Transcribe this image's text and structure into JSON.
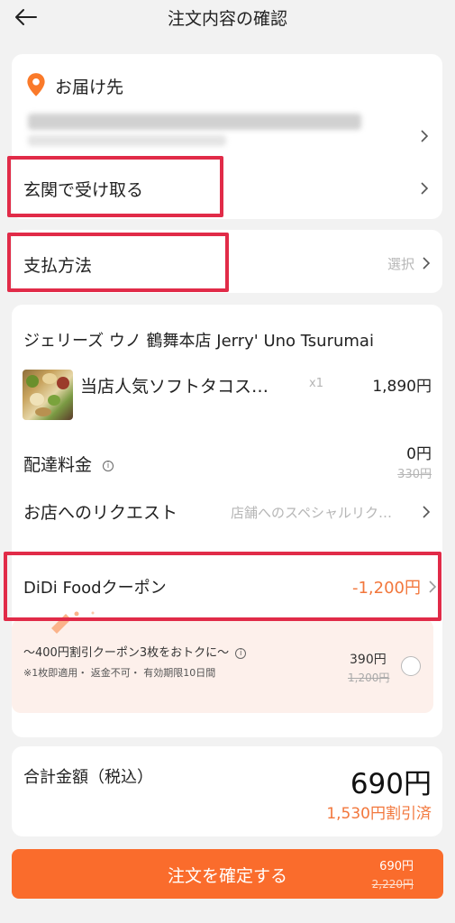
{
  "header": {
    "title": "注文内容の確認"
  },
  "delivery": {
    "title": "お届け先",
    "pickup_label": "玄関で受け取る"
  },
  "payment": {
    "label": "支払方法",
    "select_text": "選択"
  },
  "store": {
    "name": "ジェリーズ ウノ 鶴舞本店 Jerry' Uno Tsurumai",
    "item": {
      "name": "当店人気ソフトタコス…",
      "qty": "x1",
      "price": "1,890円"
    },
    "delivery_fee": {
      "label": "配達料金",
      "price": "0円",
      "original": "330円"
    },
    "request": {
      "label": "お店へのリクエスト",
      "placeholder": "店舗へのスペシャルリク…"
    }
  },
  "coupon": {
    "label": "DiDi Foodクーポン",
    "amount": "-1,200円",
    "promo_title": "～400円割引クーポン3枚をおトクに～",
    "promo_note": "※1枚即適用・ 返金不可・ 有効期限10日間",
    "promo_price": "390円",
    "promo_original": "1,200円"
  },
  "total": {
    "label": "合計金額（税込）",
    "amount": "690円",
    "discount": "1,530円割引済"
  },
  "footer": {
    "confirm_label": "注文を確定する",
    "price": "690円",
    "original": "2,220円"
  },
  "colors": {
    "accent": "#fa6c2c",
    "discount_text": "#f2773c",
    "highlight_box": "#e12b48",
    "background": "#f2f2f2"
  }
}
